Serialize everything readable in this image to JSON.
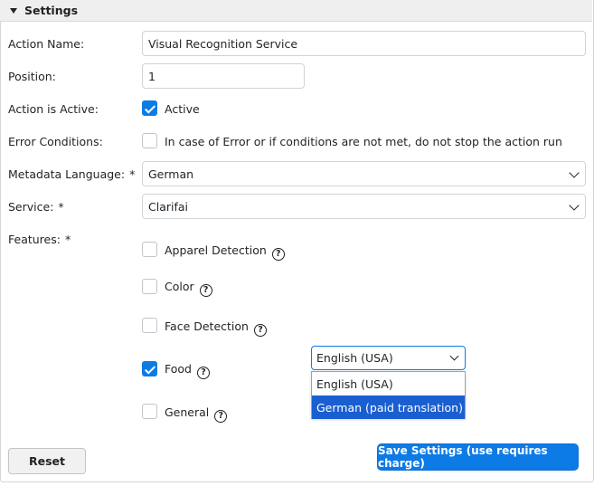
{
  "header": {
    "title": "Settings"
  },
  "fields": {
    "action_name": {
      "label": "Action Name:",
      "value": "Visual Recognition Service"
    },
    "position": {
      "label": "Position:",
      "value": "1"
    },
    "active": {
      "label": "Action is Active:",
      "checkbox_label": "Active",
      "checked": true
    },
    "error": {
      "label": "Error Conditions:",
      "checkbox_label": "In case of Error or if conditions are not met, do not stop the action run",
      "checked": false
    },
    "metadata_language": {
      "label": "Metadata Language:",
      "required": "*",
      "value": "German"
    },
    "service": {
      "label": "Service:",
      "required": "*",
      "value": "Clarifai"
    },
    "features": {
      "label": "Features:",
      "required": "*",
      "items": [
        {
          "label": "Apparel Detection",
          "checked": false
        },
        {
          "label": "Color",
          "checked": false
        },
        {
          "label": "Face Detection",
          "checked": false
        },
        {
          "label": "Food",
          "checked": true
        },
        {
          "label": "General",
          "checked": false
        }
      ]
    }
  },
  "food_language": {
    "value": "English (USA)",
    "options": [
      "English (USA)",
      "German (paid translation)"
    ],
    "highlighted": "German (paid translation)"
  },
  "help_glyph": "?",
  "buttons": {
    "reset": "Reset",
    "save": "Save Settings (use requires charge)"
  },
  "colors": {
    "accent": "#0d7be6",
    "highlight": "#1a5fd1"
  }
}
